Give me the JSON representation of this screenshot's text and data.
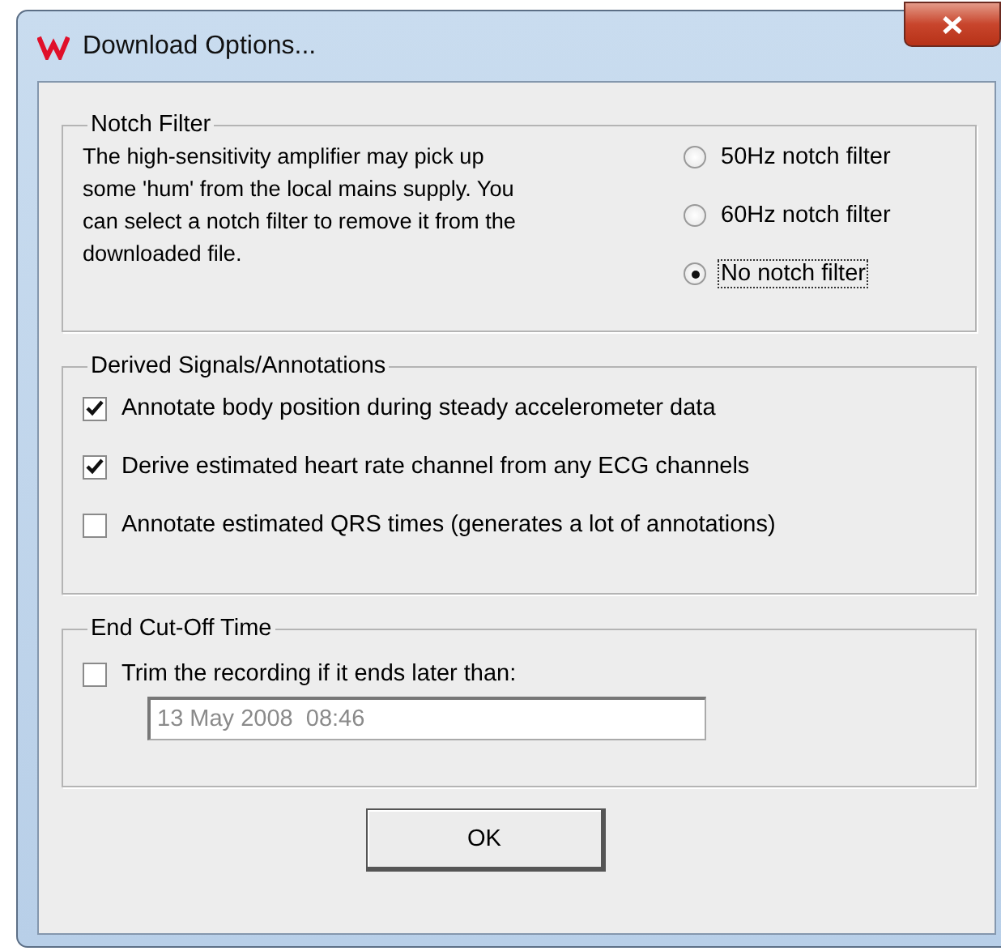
{
  "window": {
    "title": "Download Options..."
  },
  "notch_filter": {
    "title": "Notch Filter",
    "description": "The high-sensitivity amplifier may pick up some 'hum' from the local mains supply. You can select a notch filter to remove it from the downloaded file.",
    "options": [
      {
        "label": "50Hz notch filter",
        "selected": false
      },
      {
        "label": "60Hz notch filter",
        "selected": false
      },
      {
        "label": "No notch filter",
        "selected": true
      }
    ]
  },
  "derived": {
    "title": "Derived Signals/Annotations",
    "options": [
      {
        "label": "Annotate body position during steady accelerometer data",
        "checked": true
      },
      {
        "label": "Derive estimated heart rate channel from any ECG channels",
        "checked": true
      },
      {
        "label": "Annotate estimated QRS times (generates a lot of annotations)",
        "checked": false
      }
    ]
  },
  "cutoff": {
    "title": "End Cut-Off Time",
    "option": {
      "label": "Trim the recording if it ends later than:",
      "checked": false
    },
    "field": {
      "value": "13 May 2008  08:46",
      "disabled": true
    }
  },
  "buttons": [
    "OK"
  ]
}
